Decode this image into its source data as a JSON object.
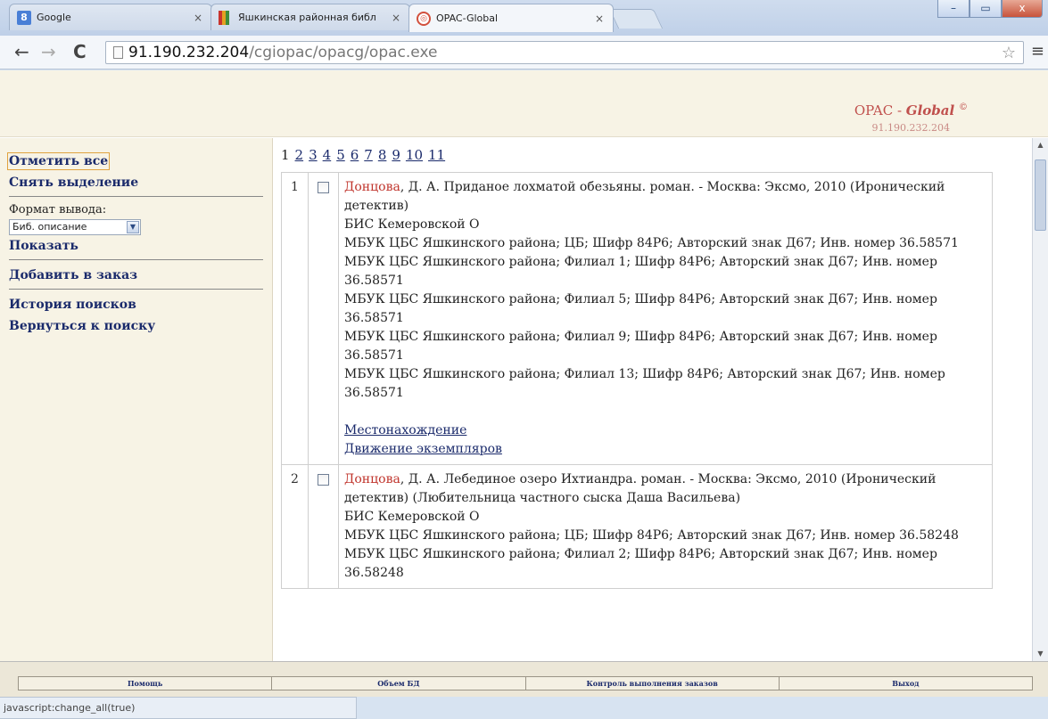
{
  "browser": {
    "tabs": [
      {
        "title": "Google",
        "favicon": "google-icon"
      },
      {
        "title": "Яшкинская районная библ",
        "favicon": "library-icon"
      },
      {
        "title": "OPAC-Global",
        "favicon": "opac-icon"
      }
    ],
    "close_glyph": "×",
    "url_host": "91.190.232.204",
    "url_path": "/cgiopac/opacg/opac.exe",
    "window_controls": {
      "minimize": "–",
      "maximize": "▭",
      "close": "x"
    }
  },
  "header": {
    "brand_prefix": "OPAC - ",
    "brand_italic": "Global",
    "brand_symbol": "©",
    "server_ip": "91.190.232.204"
  },
  "sidebar": {
    "select_all": "Отметить все",
    "deselect": "Снять выделение",
    "format_label": "Формат вывода:",
    "format_value": "Биб. описание",
    "show": "Показать",
    "add_to_order": "Добавить в заказ",
    "search_history": "История поисков",
    "back_to_search": "Вернуться к поиску"
  },
  "pager": {
    "current": "1",
    "pages": [
      "2",
      "3",
      "4",
      "5",
      "6",
      "7",
      "8",
      "9",
      "10",
      "11"
    ]
  },
  "results": [
    {
      "num": "1",
      "author": "Донцова",
      "title_line": ", Д. А. Приданое лохматой обезьяны. роман. - Москва: Эксмо, 2010 (Иронический детектив)",
      "lines": [
        "БИС Кемеровской О",
        "МБУК ЦБС Яшкинского района; ЦБ; Шифр 84Р6; Авторский знак Д67; Инв. номер 36.58571",
        "МБУК ЦБС Яшкинского района; Филиал 1; Шифр 84Р6; Авторский знак Д67; Инв. номер 36.58571",
        "МБУК ЦБС Яшкинского района; Филиал 5; Шифр 84Р6; Авторский знак Д67; Инв. номер 36.58571",
        "МБУК ЦБС Яшкинского района; Филиал 9; Шифр 84Р6; Авторский знак Д67; Инв. номер 36.58571",
        "МБУК ЦБС Яшкинского района; Филиал 13; Шифр 84Р6; Авторский знак Д67; Инв. номер 36.58571"
      ],
      "link_location": "Местонахождение",
      "link_movement": "Движение экземпляров"
    },
    {
      "num": "2",
      "author": "Донцова",
      "title_line": ", Д. А. Лебединое озеро Ихтиандра. роман. - Москва: Эксмо, 2010 (Иронический детектив) (Любительница частного сыска Даша Васильева)",
      "lines": [
        "БИС Кемеровской О",
        "МБУК ЦБС Яшкинского района; ЦБ; Шифр 84Р6; Авторский знак Д67; Инв. номер 36.58248",
        "МБУК ЦБС Яшкинского района; Филиал 2; Шифр 84Р6; Авторский знак Д67; Инв. номер 36.58248"
      ]
    }
  ],
  "footer": {
    "help": "Помощь",
    "db_size": "Объем БД",
    "order_control": "Контроль выполнения заказов",
    "exit": "Выход"
  },
  "status_bar": "javascript:change_all(true)"
}
